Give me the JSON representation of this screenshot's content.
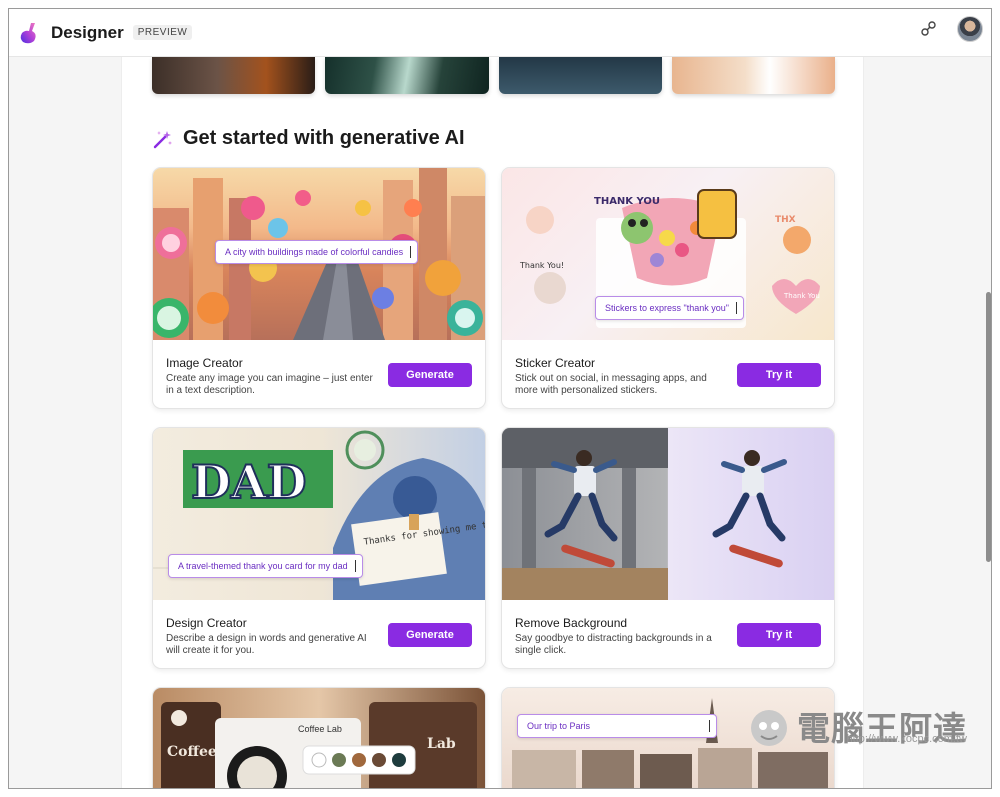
{
  "header": {
    "app_title": "Designer",
    "badge": "PREVIEW"
  },
  "section": {
    "title": "Get started with generative AI"
  },
  "cards": [
    {
      "name": "Image Creator",
      "description": "Create any image you can imagine – just enter in a text description.",
      "button": "Generate",
      "prompt": "A city with buildings made of colorful candies"
    },
    {
      "name": "Sticker Creator",
      "description": "Stick out on social, in messaging apps, and more with personalized stickers.",
      "button": "Try it",
      "prompt": "Stickers to express \"thank you\"",
      "art_text": [
        "THANK YOU",
        "Thank You!",
        "THX",
        "Thank You"
      ]
    },
    {
      "name": "Design Creator",
      "description": "Describe a design in words and generative AI will create it for you.",
      "button": "Generate",
      "prompt": "A travel-themed thank you card for my dad",
      "art_text": [
        "DAD",
        "Thanks for showing me the world."
      ]
    },
    {
      "name": "Remove Background",
      "description": "Say goodbye to distracting backgrounds in a single click.",
      "button": "Try it"
    }
  ],
  "bottom_cards": [
    {
      "label": "Coffee Lab",
      "art_text": [
        "Coffee Lab",
        "Lab"
      ],
      "swatches": [
        "#ffffff",
        "#6b7a55",
        "#a0683d",
        "#6a4a36",
        "#1e3c3e"
      ]
    },
    {
      "prompt": "Our trip to Paris"
    }
  ],
  "watermark": {
    "text": "電腦王阿達",
    "url": "http://www.kocpc.com.tw"
  },
  "colors": {
    "accent": "#8a2be2",
    "prompt_text": "#6b2fc2"
  }
}
